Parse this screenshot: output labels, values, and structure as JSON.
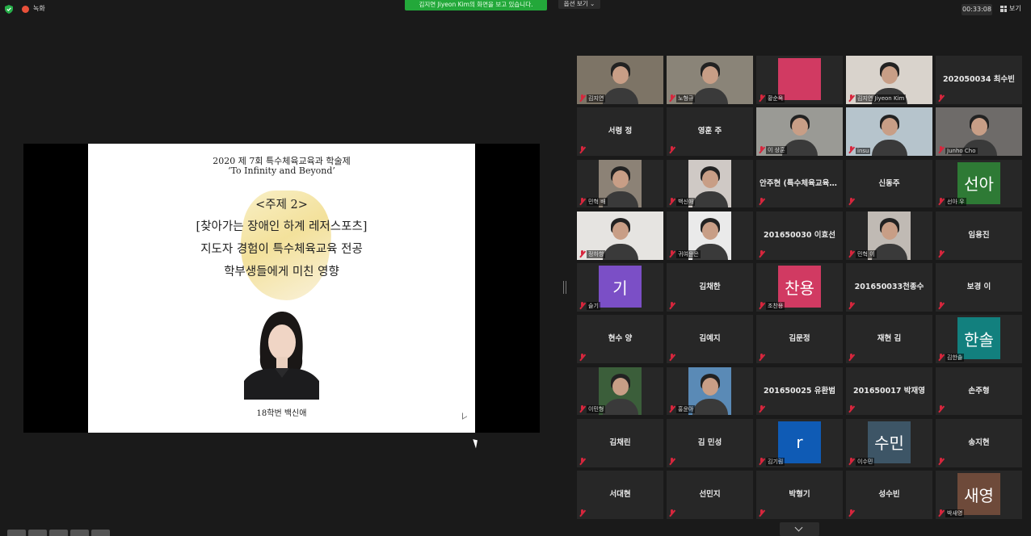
{
  "topbar": {
    "recording_label": "녹화",
    "share_banner": "김지연 Jiyeon Kim의 화면을 보고 있습니다.",
    "view_options": "옵션 보기 ⌄",
    "timer": "00:33:08",
    "view_label": "보기"
  },
  "slide": {
    "title1": "2020 제 7회 특수체육교육과 학술제",
    "title2": "‘To Infinity and Beyond’",
    "topic": "<주제 2>",
    "line2": "[찾아가는 장애인 하계 레저스포츠]",
    "line3": "지도자 경험이 특수체육교육 전공",
    "line4": "학부생들에게 미친 영향",
    "caption": "18학번 백신애"
  },
  "participants": [
    {
      "kind": "video",
      "label": "김지연",
      "bg": "#7d7466"
    },
    {
      "kind": "video",
      "label": "노형규",
      "bg": "#8a8478"
    },
    {
      "kind": "avatar",
      "initial": "",
      "color": "#d13a62",
      "label": "황순옥"
    },
    {
      "kind": "video",
      "label": "김지연 Jiyeon Kim",
      "bg": "#d9d3cc",
      "active": true
    },
    {
      "kind": "name",
      "name": "202050034 최수빈"
    },
    {
      "kind": "name",
      "name": "서령 정"
    },
    {
      "kind": "name",
      "name": "영훈 주"
    },
    {
      "kind": "video",
      "label": "이 상훈",
      "bg": "#9a9a95"
    },
    {
      "kind": "video",
      "label": "insu",
      "bg": "#b6c4cc"
    },
    {
      "kind": "video",
      "label": "Junho Cho",
      "bg": "#6e6b69"
    },
    {
      "kind": "video",
      "label": "민혁 배",
      "bg": "#8c8276"
    },
    {
      "kind": "video",
      "label": "백신애",
      "bg": "#cfc9c5"
    },
    {
      "kind": "name",
      "name": "안주현 (특수체육교육과)"
    },
    {
      "kind": "name",
      "name": "신동주"
    },
    {
      "kind": "avatar",
      "initial": "선아",
      "color": "#2e7a35",
      "label": "선아 우"
    },
    {
      "kind": "video",
      "label": "정하향",
      "bg": "#e6e4e1"
    },
    {
      "kind": "video",
      "label": "귀여운은",
      "bg": "#eaeaea"
    },
    {
      "kind": "name",
      "name": "201650030 이효선"
    },
    {
      "kind": "video",
      "label": "민혁 이",
      "bg": "#c0bab4"
    },
    {
      "kind": "name",
      "name": "임용진"
    },
    {
      "kind": "avatar",
      "initial": "기",
      "color": "#7b4fc6",
      "label": "슬기"
    },
    {
      "kind": "name",
      "name": "김채한"
    },
    {
      "kind": "avatar",
      "initial": "찬용",
      "color": "#d13a62",
      "label": "조찬용"
    },
    {
      "kind": "name",
      "name": "201650033천종수"
    },
    {
      "kind": "name",
      "name": "보경 이"
    },
    {
      "kind": "name",
      "name": "현수 양"
    },
    {
      "kind": "name",
      "name": "김예지"
    },
    {
      "kind": "name",
      "name": "김문정"
    },
    {
      "kind": "name",
      "name": "재현 김"
    },
    {
      "kind": "avatar",
      "initial": "한솔",
      "color": "#12807e",
      "label": "김한솔"
    },
    {
      "kind": "video",
      "label": "이민형",
      "bg": "#3b5e3a"
    },
    {
      "kind": "video",
      "label": "홍윤아",
      "bg": "#5a8ab6"
    },
    {
      "kind": "name",
      "name": "201650025 유환범"
    },
    {
      "kind": "name",
      "name": "201650017 박재영"
    },
    {
      "kind": "name",
      "name": "손주형"
    },
    {
      "kind": "name",
      "name": "김채린"
    },
    {
      "kind": "name",
      "name": "김 민성"
    },
    {
      "kind": "avatar",
      "initial": "r",
      "color": "#0f5bb5",
      "label": "김기림"
    },
    {
      "kind": "avatar",
      "initial": "수민",
      "color": "#3d5566",
      "label": "이수민"
    },
    {
      "kind": "name",
      "name": "송지현"
    },
    {
      "kind": "name",
      "name": "서대현"
    },
    {
      "kind": "name",
      "name": "선민지"
    },
    {
      "kind": "name",
      "name": "박형기"
    },
    {
      "kind": "name",
      "name": "성수빈"
    },
    {
      "kind": "avatar",
      "initial": "새영",
      "color": "#6e4a3a",
      "label": "박새영"
    }
  ]
}
